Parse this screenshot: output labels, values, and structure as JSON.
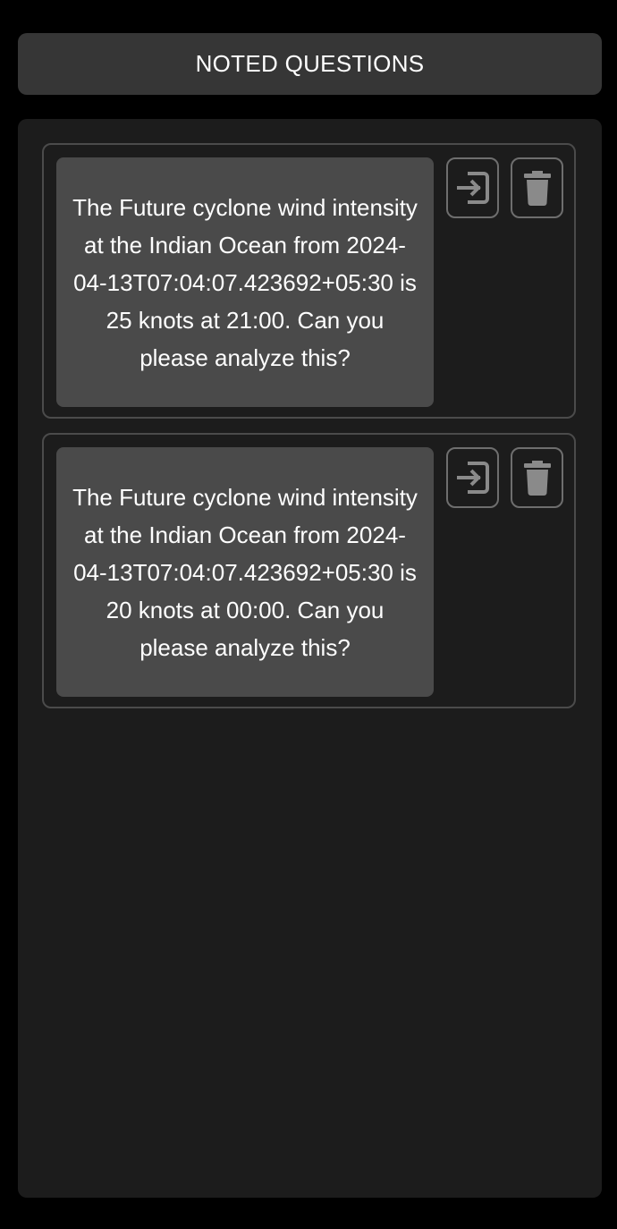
{
  "header": {
    "title": "NOTED QUESTIONS"
  },
  "questions": [
    {
      "text": "The Future cyclone wind intensity at the Indian Ocean from 2024-04-13T07:04:07.423692+05:30 is 25 knots at 21:00. Can you please analyze this?",
      "actions": [
        "insert-icon",
        "trash-icon"
      ]
    },
    {
      "text": "The Future cyclone wind intensity at the Indian Ocean from 2024-04-13T07:04:07.423692+05:30 is 20 knots at 00:00. Can you please analyze this?",
      "actions": [
        "insert-icon",
        "trash-icon"
      ]
    }
  ],
  "colors": {
    "background": "#000000",
    "header_bg": "#363636",
    "panel_bg": "#1c1c1c",
    "card_border": "#4b4b4b",
    "question_bg": "#4a4a4a",
    "icon": "#8a8a8a",
    "text": "#ffffff"
  }
}
